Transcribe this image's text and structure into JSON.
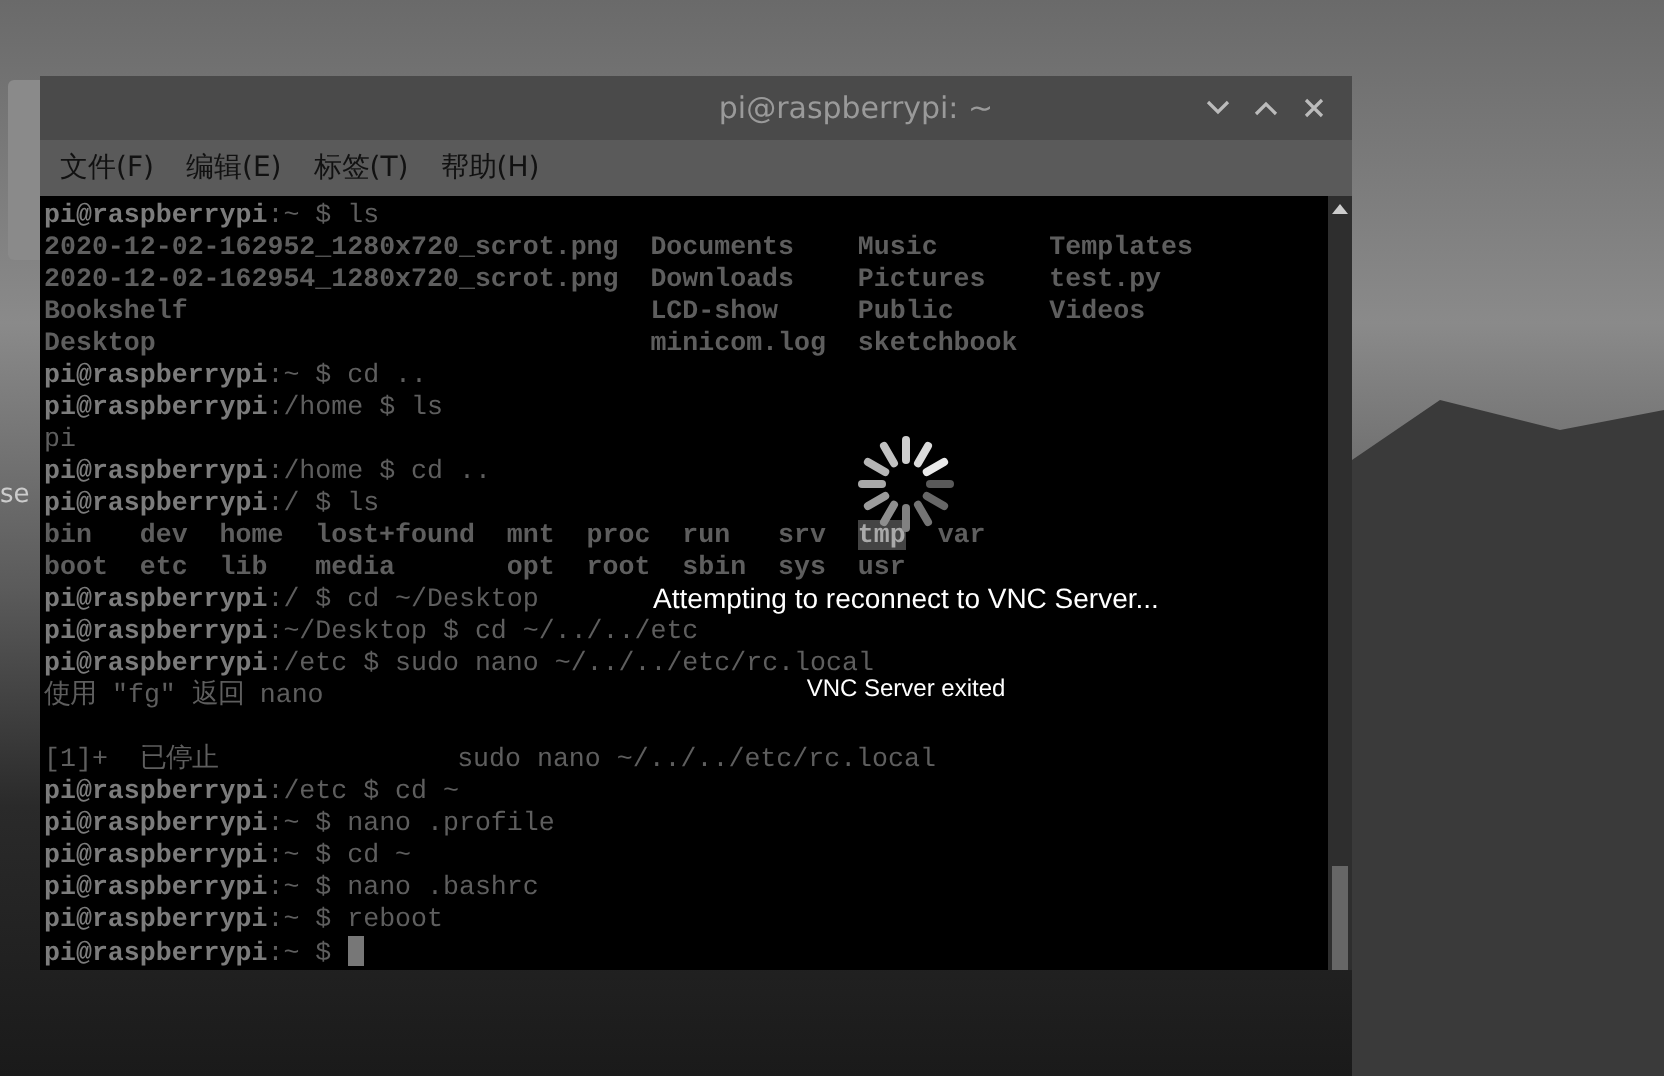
{
  "desktop": {
    "icon_label": "se"
  },
  "window": {
    "title": "pi@raspberrypi: ~"
  },
  "menu": [
    {
      "label": "文件(F)"
    },
    {
      "label": "编辑(E)"
    },
    {
      "label": "标签(T)"
    },
    {
      "label": "帮助(H)"
    }
  ],
  "terminal": {
    "lines": [
      {
        "kind": "text",
        "text": "**pi@raspberrypi**:~ $ ls"
      },
      {
        "kind": "listing",
        "rows": [
          [
            {
              "text": "2020-12-02-162952_1280x720_scrot.png",
              "highlighted": false
            },
            {
              "text": "Documents",
              "highlighted": false
            },
            {
              "text": "Music",
              "highlighted": false
            },
            {
              "text": "Templates",
              "highlighted": false
            }
          ],
          [
            {
              "text": "2020-12-02-162954_1280x720_scrot.png",
              "highlighted": false
            },
            {
              "text": "Downloads",
              "highlighted": false
            },
            {
              "text": "Pictures",
              "highlighted": false
            },
            {
              "text": "test.py",
              "highlighted": false
            }
          ],
          [
            {
              "text": "Bookshelf",
              "highlighted": false
            },
            {
              "text": "LCD-show",
              "highlighted": false
            },
            {
              "text": "Public",
              "highlighted": false
            },
            {
              "text": "Videos",
              "highlighted": false
            }
          ],
          [
            {
              "text": "Desktop",
              "highlighted": false
            },
            {
              "text": "minicom.log",
              "highlighted": false
            },
            {
              "text": "sketchbook",
              "highlighted": false
            }
          ]
        ]
      },
      {
        "kind": "text",
        "text": "**pi@raspberrypi**:~ $ cd .."
      },
      {
        "kind": "text",
        "text": "**pi@raspberrypi**:/home $ ls"
      },
      {
        "kind": "text",
        "text": "pi"
      },
      {
        "kind": "text",
        "text": "**pi@raspberrypi**:/home $ cd .."
      },
      {
        "kind": "text",
        "text": "**pi@raspberrypi**:/ $ ls"
      },
      {
        "kind": "listing",
        "rows": [
          [
            {
              "text": "bin",
              "highlighted": false
            },
            {
              "text": "dev",
              "highlighted": false
            },
            {
              "text": "home",
              "highlighted": false
            },
            {
              "text": "lost+found",
              "highlighted": false
            },
            {
              "text": "mnt",
              "highlighted": false
            },
            {
              "text": "proc",
              "highlighted": false
            },
            {
              "text": "run",
              "highlighted": false
            },
            {
              "text": "srv",
              "highlighted": false
            },
            {
              "text": "tmp",
              "highlighted": true
            },
            {
              "text": "var",
              "highlighted": false
            }
          ],
          [
            {
              "text": "boot",
              "highlighted": false
            },
            {
              "text": "etc",
              "highlighted": false
            },
            {
              "text": "lib",
              "highlighted": false
            },
            {
              "text": "media",
              "highlighted": false
            },
            {
              "text": "opt",
              "highlighted": false
            },
            {
              "text": "root",
              "highlighted": false
            },
            {
              "text": "sbin",
              "highlighted": false
            },
            {
              "text": "sys",
              "highlighted": false
            },
            {
              "text": "usr",
              "highlighted": false
            }
          ]
        ]
      },
      {
        "kind": "text",
        "text": "**pi@raspberrypi**:/ $ cd ~/Desktop"
      },
      {
        "kind": "text",
        "text": "**pi@raspberrypi**:~/Desktop $ cd ~/../../etc"
      },
      {
        "kind": "text",
        "text": "**pi@raspberrypi**:/etc $ sudo nano ~/../../etc/rc.local"
      },
      {
        "kind": "text",
        "text": "使用 \"fg\" 返回 nano"
      },
      {
        "kind": "blank"
      },
      {
        "kind": "text",
        "text": "[1]+  已停止               sudo nano ~/../../etc/rc.local"
      },
      {
        "kind": "text",
        "text": "**pi@raspberrypi**:/etc $ cd ~"
      },
      {
        "kind": "text",
        "text": "**pi@raspberrypi**:~ $ nano .profile"
      },
      {
        "kind": "text",
        "text": "**pi@raspberrypi**:~ $ cd ~"
      },
      {
        "kind": "text",
        "text": "**pi@raspberrypi**:~ $ nano .bashrc"
      },
      {
        "kind": "text",
        "text": "**pi@raspberrypi**:~ $ reboot"
      },
      {
        "kind": "cursor",
        "text": "**pi@raspberrypi**:~ $ "
      }
    ]
  },
  "overlay": {
    "message": "Attempting to reconnect to VNC Server...",
    "detail": "VNC Server exited"
  }
}
